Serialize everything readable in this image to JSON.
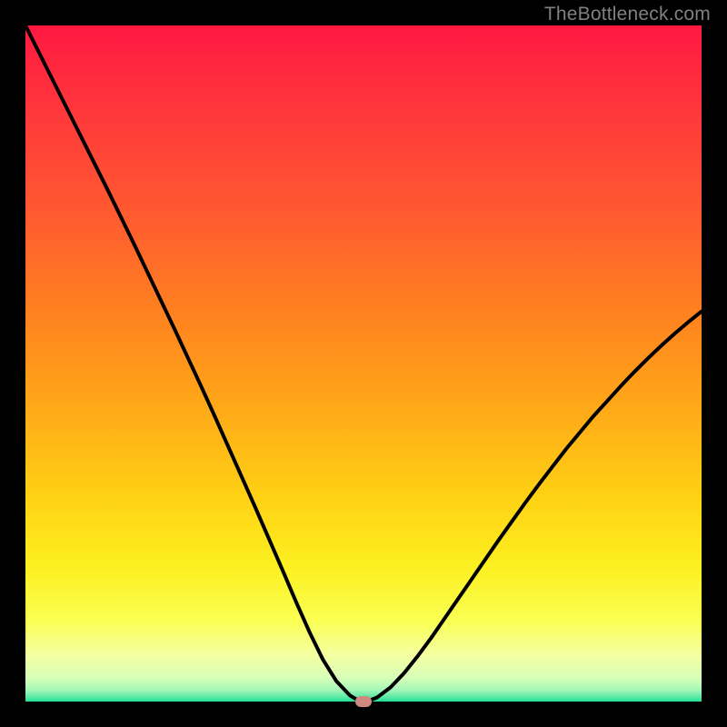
{
  "watermark": "TheBottleneck.com",
  "gradient_stops": [
    {
      "id": "g0",
      "color": "#ff1842"
    },
    {
      "id": "g1",
      "color": "#ff3a3a"
    },
    {
      "id": "g2",
      "color": "#ff5a30"
    },
    {
      "id": "g3",
      "color": "#ff8020"
    },
    {
      "id": "g4",
      "color": "#ffa718"
    },
    {
      "id": "g5",
      "color": "#ffd214"
    },
    {
      "id": "g6",
      "color": "#fcf020"
    },
    {
      "id": "g7",
      "color": "#faff52"
    },
    {
      "id": "g8",
      "color": "#f4ffa0"
    },
    {
      "id": "g9",
      "color": "#d8ffb8"
    },
    {
      "id": "g10",
      "color": "#a8f7b8"
    },
    {
      "id": "g11",
      "color": "#5fe9a6"
    },
    {
      "id": "g12",
      "color": "#20e096"
    }
  ],
  "chart_data": {
    "type": "line",
    "title": "",
    "xlabel": "",
    "ylabel": "",
    "xlim": [
      0,
      100
    ],
    "ylim": [
      0,
      100
    ],
    "x": [
      0,
      2,
      4,
      6,
      8,
      10,
      12,
      14,
      16,
      18,
      20,
      22,
      24,
      26,
      28,
      30,
      32,
      34,
      36,
      38,
      40,
      42,
      44,
      46,
      48,
      49.5,
      50.5,
      52,
      54,
      56,
      58,
      60,
      62,
      64,
      66,
      68,
      70,
      72,
      74,
      76,
      78,
      80,
      82,
      84,
      86,
      88,
      90,
      92,
      94,
      96,
      98,
      100
    ],
    "values": [
      100,
      96.0,
      92.0,
      88.0,
      84.0,
      80.0,
      76.0,
      71.9,
      67.8,
      63.6,
      59.4,
      55.2,
      50.9,
      46.6,
      42.2,
      37.7,
      33.2,
      28.7,
      24.1,
      19.5,
      14.8,
      10.3,
      6.2,
      3.0,
      0.9,
      0.0,
      0.0,
      0.6,
      2.1,
      4.2,
      6.7,
      9.4,
      12.3,
      15.2,
      18.1,
      21.0,
      23.9,
      26.7,
      29.5,
      32.2,
      34.8,
      37.4,
      39.8,
      42.2,
      44.4,
      46.6,
      48.7,
      50.7,
      52.6,
      54.4,
      56.1,
      57.7
    ],
    "marker": {
      "x": 50,
      "y": 0
    }
  }
}
